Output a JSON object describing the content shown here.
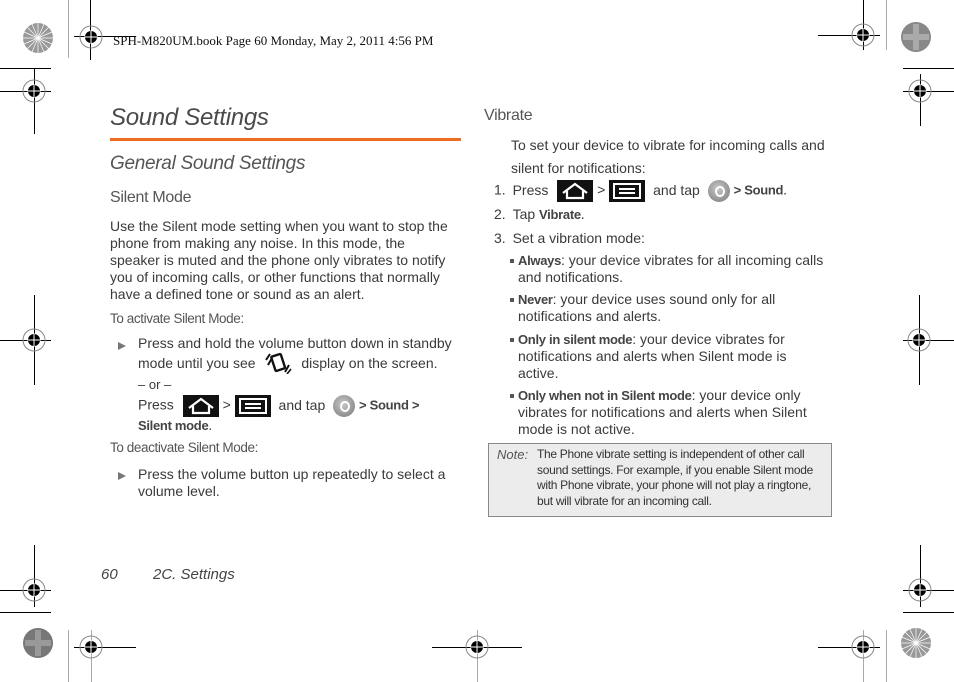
{
  "header": {
    "print_line": "SPH-M820UM.book  Page 60  Monday, May 2, 2011  4:56 PM"
  },
  "title": "Sound Settings",
  "section": "General Sound Settings",
  "left": {
    "heading": "Silent Mode",
    "intro_lines": [
      "Use the Silent mode setting when you want to stop the",
      "phone from making any noise. In this mode, the",
      "speaker is muted and the phone only vibrates to notify",
      "you of incoming calls, or other functions that normally",
      "have a defined tone or sound as an alert."
    ],
    "activate_label": "To activate Silent Mode:",
    "activate_step_line1": "Press and hold the volume button down in standby",
    "activate_step_line2a": "mode until you see",
    "activate_step_line2b": "display on the screen.",
    "or_text": "– or –",
    "press_text": "Press",
    "gt": ">",
    "and_tap": "and tap",
    "sound_path": "> Sound >",
    "silent_mode": "Silent mode",
    "period": ".",
    "deactivate_label": "To deactivate Silent Mode:",
    "deactivate_line1": "Press the volume button up repeatedly to select a",
    "deactivate_line2": "volume level."
  },
  "right": {
    "heading": "Vibrate",
    "intro_line1": "To set your device to vibrate for incoming calls and",
    "intro_line2": "silent for notifications:",
    "steps": [
      {
        "num": "1.",
        "text": "Press",
        "gt": ">",
        "and_tap": "and tap",
        "sound": "> Sound",
        "end": "."
      },
      {
        "num": "2.",
        "text": "Tap",
        "bold": "Vibrate",
        "end": "."
      },
      {
        "num": "3.",
        "text": "Set a vibration mode:"
      }
    ],
    "modes": [
      {
        "name": "Always",
        "line1": ": your device vibrates for all incoming calls",
        "line2": "and notifications."
      },
      {
        "name": "Never",
        "line1": ": your device uses sound only for all",
        "line2": "notifications and alerts."
      },
      {
        "name": "Only in silent mode",
        "line1": ": your device vibrates for",
        "line2": "notifications and alerts when Silent mode is",
        "line3": "active."
      },
      {
        "name": "Only when not in Silent mode",
        "line1": ": your device only",
        "line2": "vibrates for notifications and alerts when Silent",
        "line3": "mode is not active."
      }
    ],
    "note": {
      "label": "Note:",
      "lines": [
        "The Phone vibrate setting is independent of other call",
        "sound settings. For example, if you enable Silent mode",
        "with Phone vibrate, your phone will not play a ringtone,",
        "but will vibrate for an incoming call."
      ]
    }
  },
  "footer": {
    "page_number": "60",
    "section": "2C. Settings"
  },
  "colors": {
    "accent_rule": "#ee6b1f",
    "note_bg": "#ececec"
  }
}
